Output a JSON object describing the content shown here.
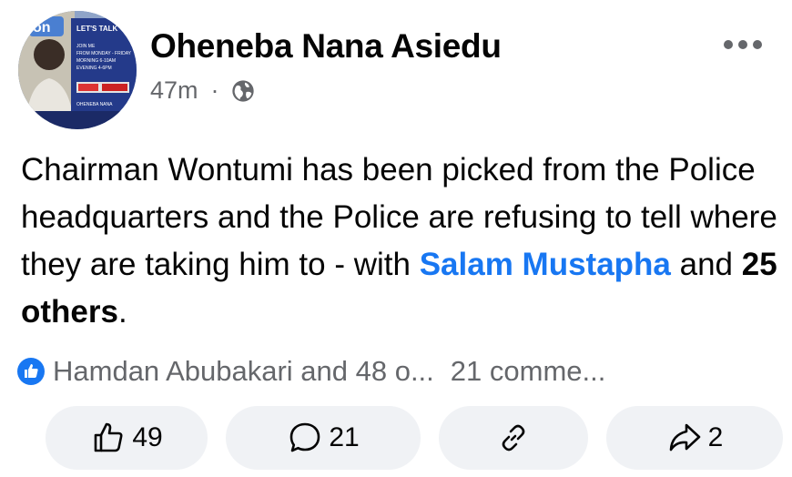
{
  "post": {
    "author": "Oheneba Nana Asiedu",
    "time": "47m",
    "separator": "·",
    "privacy_icon": "globe-icon",
    "text_part1": "Chairman Wontumi has been picked from the Police headquarters and the Police are refusing to tell where they are taking him to - with ",
    "mention": "Salam Mustapha",
    "text_part2": " and ",
    "others": "25 others",
    "text_part3": "."
  },
  "avatar": {
    "banner_line1": "LET'S TALK",
    "banner_line2": "JOIN ME",
    "banner_line3": "FROM MONDAY - FRIDAY",
    "banner_line4": "MORNING 6-10AM",
    "banner_line5": "EVENING 4-6PM",
    "banner_name": "OHENEBA NANA",
    "logo_text": "on"
  },
  "reactions": {
    "icon": "like-badge-icon",
    "summary": "Hamdan Abubakari and 48 o...",
    "comments": "21 comme..."
  },
  "actions": {
    "like_count": "49",
    "comment_count": "21",
    "share_count": "2"
  },
  "colors": {
    "mention": "#1877f2",
    "secondary_text": "#65676b",
    "button_bg": "#f0f2f5"
  }
}
